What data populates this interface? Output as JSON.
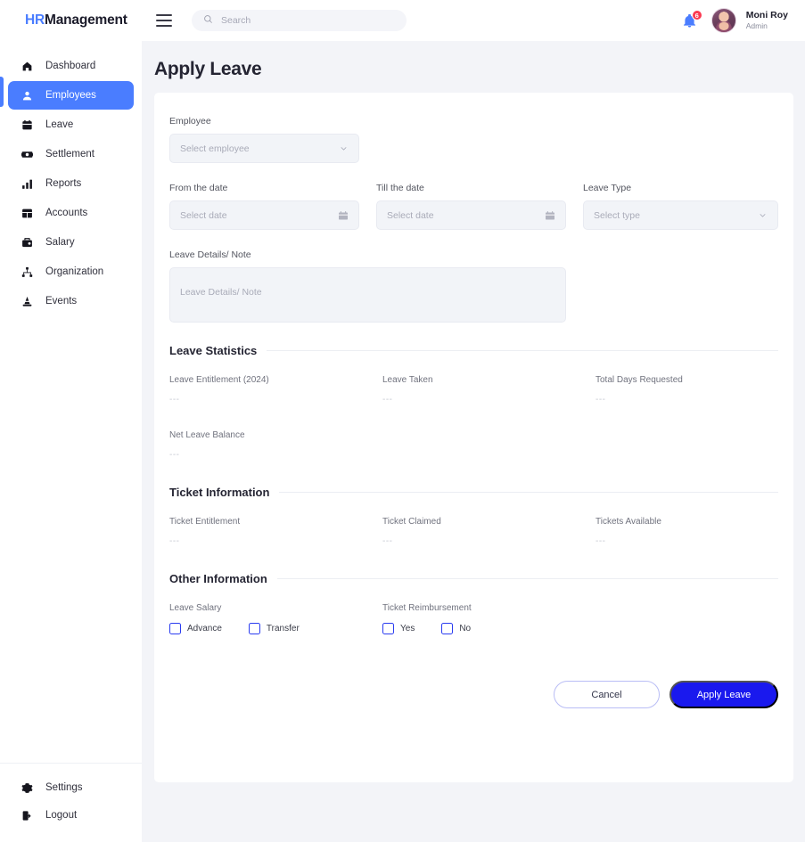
{
  "brand": {
    "prefix": "HR",
    "suffix": "Management"
  },
  "sidebar": {
    "items": [
      {
        "label": "Dashboard",
        "icon": "home-icon"
      },
      {
        "label": "Employees",
        "icon": "user-icon"
      },
      {
        "label": "Leave",
        "icon": "calendar-icon"
      },
      {
        "label": "Settlement",
        "icon": "money-icon"
      },
      {
        "label": "Reports",
        "icon": "bar-chart-icon"
      },
      {
        "label": "Accounts",
        "icon": "grid-icon"
      },
      {
        "label": "Salary",
        "icon": "briefcase-icon"
      },
      {
        "label": "Organization",
        "icon": "sitemap-icon"
      },
      {
        "label": "Events",
        "icon": "cone-icon"
      }
    ],
    "bottom": [
      {
        "label": "Settings",
        "icon": "gear-icon"
      },
      {
        "label": "Logout",
        "icon": "logout-icon"
      }
    ]
  },
  "topbar": {
    "search_placeholder": "Search",
    "notification_count": "6",
    "user_name": "Moni Roy",
    "user_role": "Admin"
  },
  "page": {
    "title": "Apply Leave"
  },
  "form": {
    "employee_label": "Employee",
    "employee_value": "Select employee",
    "from_label": "From the date",
    "from_value": "Select date",
    "till_label": "Till the date",
    "till_value": "Select date",
    "leave_type_label": "Leave Type",
    "leave_type_value": "Select type",
    "details_label": "Leave Details/ Note",
    "details_placeholder": "Leave Details/ Note"
  },
  "leave_statistics": {
    "title": "Leave Statistics",
    "stats": [
      {
        "label": "Leave Entitlement (2024)",
        "value": "---"
      },
      {
        "label": "Leave Taken",
        "value": "---"
      },
      {
        "label": "Total Days Requested",
        "value": "---"
      },
      {
        "label": "Net Leave Balance",
        "value": "---"
      }
    ]
  },
  "ticket_information": {
    "title": "Ticket Information",
    "stats": [
      {
        "label": "Ticket Entitlement",
        "value": "---"
      },
      {
        "label": "Ticket Claimed",
        "value": "---"
      },
      {
        "label": "Tickets Available",
        "value": "---"
      }
    ]
  },
  "other_information": {
    "title": "Other Information",
    "leave_salary_label": "Leave Salary",
    "leave_salary_options": [
      {
        "label": "Advance",
        "checked": false
      },
      {
        "label": "Transfer",
        "checked": false
      }
    ],
    "ticket_reimbursement_label": "Ticket Reimbursement",
    "ticket_reimbursement_options": [
      {
        "label": "Yes",
        "checked": false
      },
      {
        "label": "No",
        "checked": false
      }
    ]
  },
  "actions": {
    "cancel": "Cancel",
    "apply": "Apply Leave"
  },
  "colors": {
    "accent_blue": "#4a7dff",
    "primary_button": "#1a19ee",
    "badge_red": "#fb3a52",
    "page_bg": "#f3f4f8",
    "field_bg": "#f2f4f8"
  }
}
